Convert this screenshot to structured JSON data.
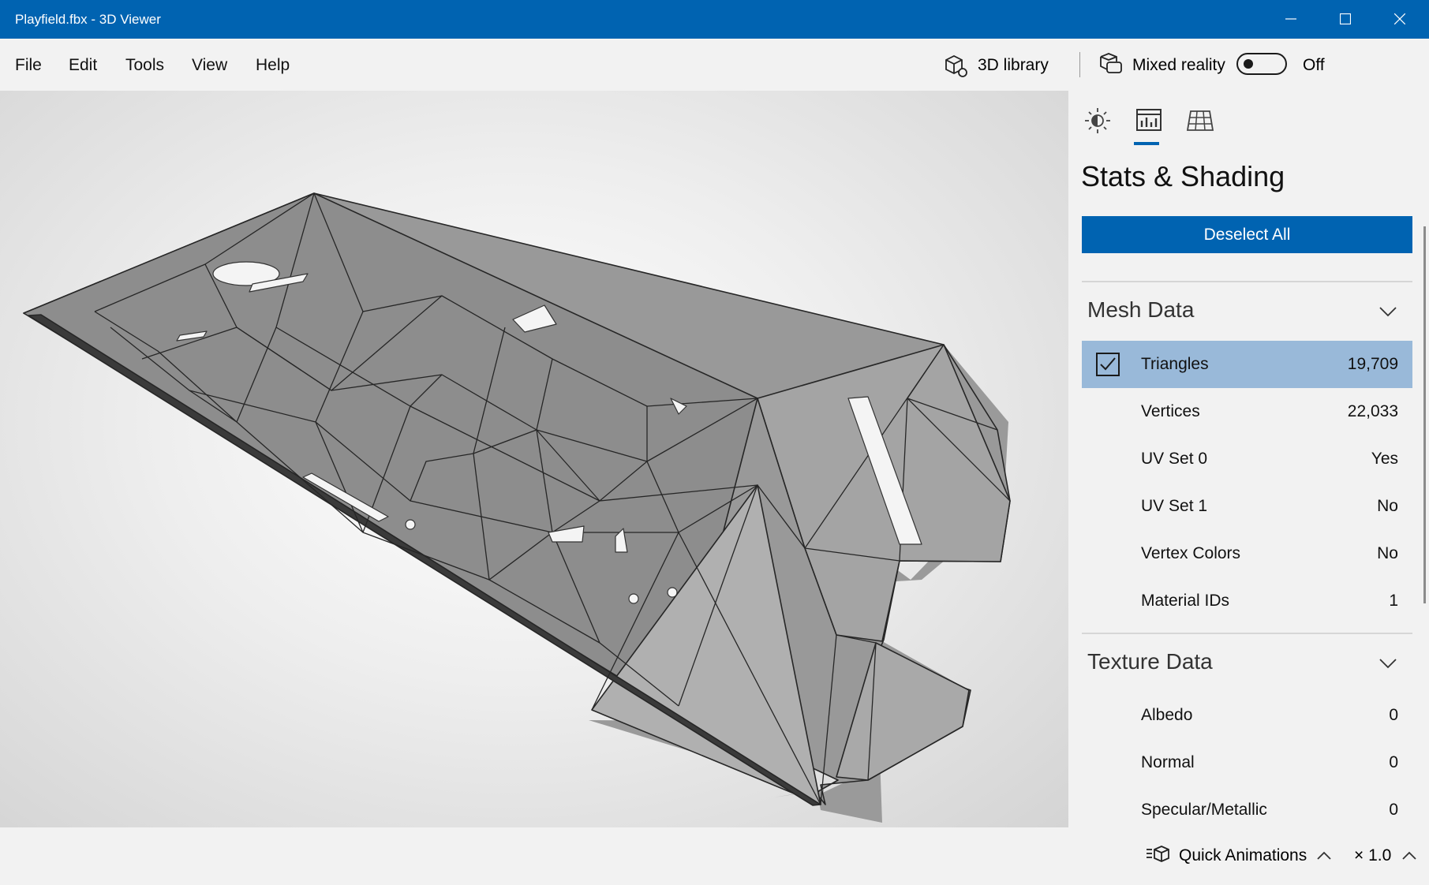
{
  "window": {
    "title": "Playfield.fbx - 3D Viewer"
  },
  "menu": {
    "file": "File",
    "edit": "Edit",
    "tools": "Tools",
    "view": "View",
    "help": "Help"
  },
  "toolbar": {
    "library_label": "3D library",
    "mixed_reality_label": "Mixed reality",
    "mixed_reality_state": "Off",
    "mixed_reality_on": false
  },
  "panel": {
    "tabs": [
      "lighting-icon",
      "stats-icon",
      "grid-icon"
    ],
    "active_tab": "stats-icon",
    "title": "Stats & Shading",
    "deselect_label": "Deselect All",
    "mesh_section": "Mesh Data",
    "mesh_rows": [
      {
        "label": "Triangles",
        "value": "19,709",
        "checked": true
      },
      {
        "label": "Vertices",
        "value": "22,033"
      },
      {
        "label": "UV Set 0",
        "value": "Yes"
      },
      {
        "label": "UV Set 1",
        "value": "No"
      },
      {
        "label": "Vertex Colors",
        "value": "No"
      },
      {
        "label": "Material IDs",
        "value": "1"
      }
    ],
    "texture_section": "Texture Data",
    "texture_rows": [
      {
        "label": "Albedo",
        "value": "0"
      },
      {
        "label": "Normal",
        "value": "0"
      },
      {
        "label": "Specular/Metallic",
        "value": "0"
      }
    ]
  },
  "status": {
    "quick_animations": "Quick Animations",
    "speed": "× 1.0"
  },
  "colors": {
    "accent": "#0063b1",
    "selected_row": "#99b9d9",
    "panel_bg": "#f2f2f2",
    "mesh": "#9a9a9a"
  }
}
